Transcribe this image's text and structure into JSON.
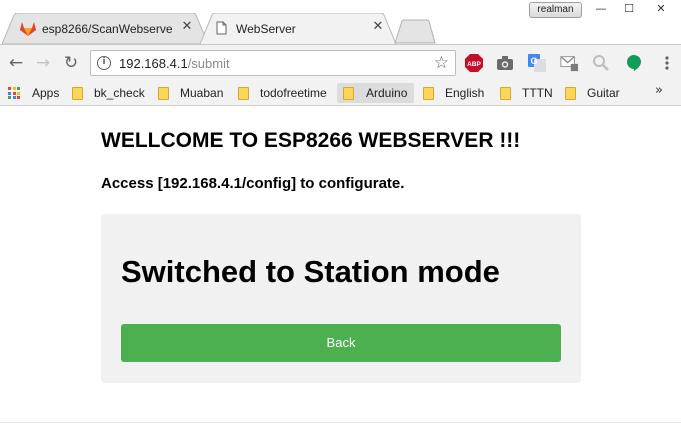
{
  "window": {
    "user_badge": "realman",
    "controls": {
      "minimize": "—",
      "maximize": "☐",
      "close": "✕"
    }
  },
  "tabs": [
    {
      "title": "esp8266/ScanWebserver",
      "icon": "gitlab-fox-icon",
      "active": false
    },
    {
      "title": "WebServer",
      "icon": "page-icon",
      "active": true
    }
  ],
  "toolbar": {
    "url_host": "192.168.4.1",
    "url_path": "/submit",
    "extensions": [
      "adblock-plus-icon",
      "camera-icon",
      "google-translate-icon",
      "gmail-checker-icon",
      "search-lens-icon",
      "hangouts-icon",
      "menu-icon"
    ],
    "abp_label": "ABP"
  },
  "bookmarks": {
    "apps_label": "Apps",
    "items": [
      "bk_check",
      "Muaban",
      "todofreetime",
      "Arduino",
      "English",
      "TTTN",
      "Guitar"
    ],
    "more": "»"
  },
  "page": {
    "heading": "WELLCOME TO ESP8266 WEBSERVER !!!",
    "subheading": "Access [192.168.4.1/config] to configurate.",
    "panel_title": "Switched to Station mode",
    "back_label": "Back"
  },
  "colors": {
    "button_green": "#4caf50",
    "panel_bg": "#f1f1f1",
    "abp_red": "#c70d2c",
    "hangouts_green": "#0f9d58"
  }
}
